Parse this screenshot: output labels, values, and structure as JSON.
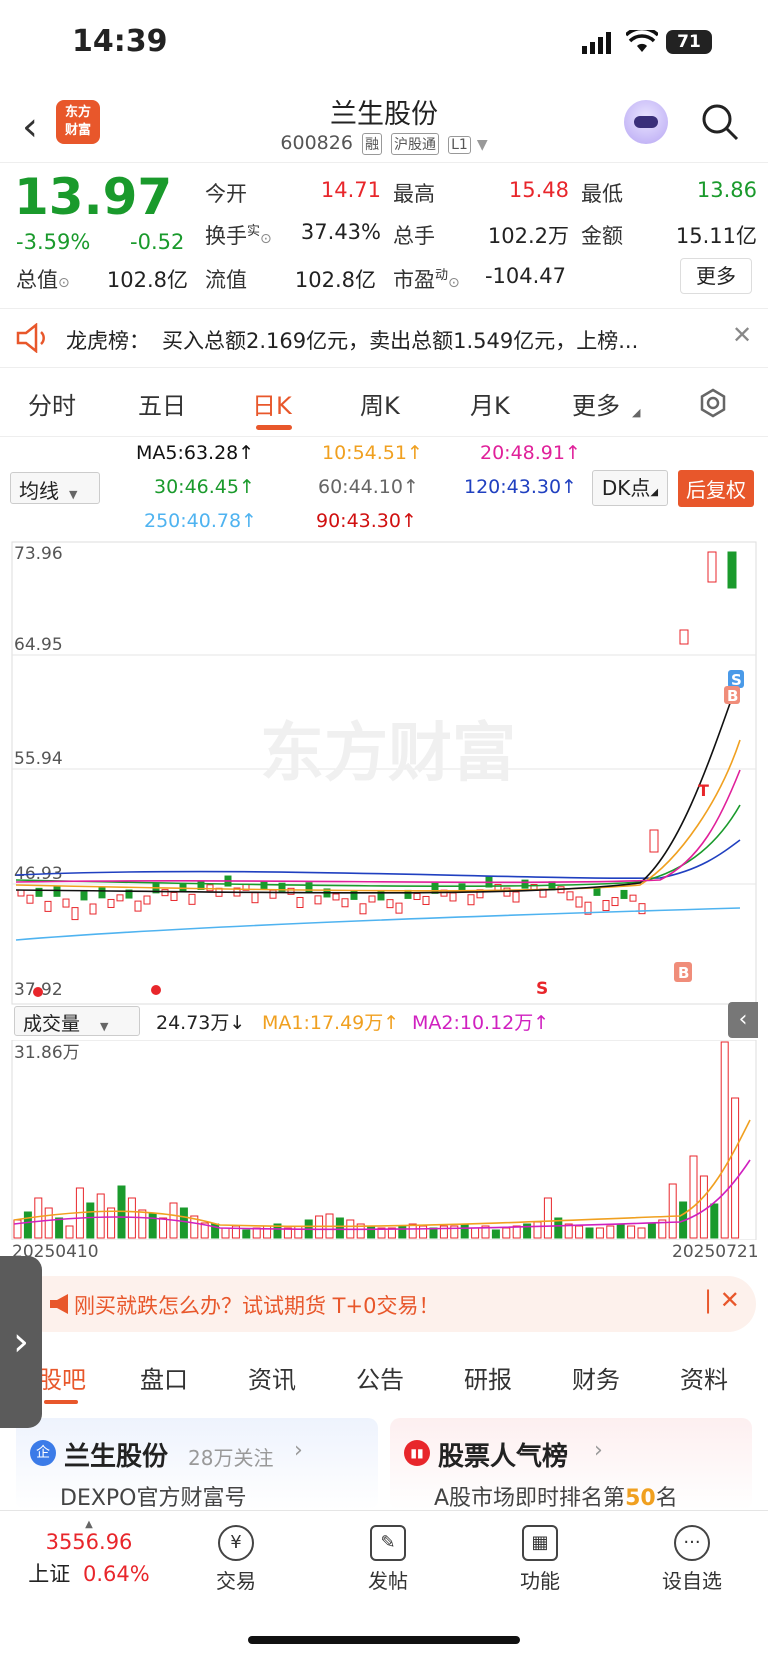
{
  "status_bar": {
    "time": "14:39",
    "battery": "71"
  },
  "header": {
    "name": "兰生股份",
    "code": "600826",
    "tags": [
      "融",
      "沪股通",
      "L1"
    ],
    "logo_lines": [
      "东方",
      "财富"
    ]
  },
  "quote": {
    "price": "13.97",
    "pct": "-3.59%",
    "change": "-0.52",
    "fields": [
      {
        "label": "今开",
        "value": "14.71",
        "color": "red"
      },
      {
        "label": "最高",
        "value": "15.48",
        "color": "red"
      },
      {
        "label": "最低",
        "value": "13.86",
        "color": "green"
      },
      {
        "label": "换手",
        "sup": "实",
        "value": "37.43%",
        "color": "dark"
      },
      {
        "label": "总手",
        "value": "102.2万",
        "color": "dark"
      },
      {
        "label": "金额",
        "value": "15.11亿",
        "color": "dark"
      },
      {
        "label": "总值",
        "value": "102.8亿",
        "color": "dark"
      },
      {
        "label": "流值",
        "value": "102.8亿",
        "color": "dark"
      },
      {
        "label": "市盈",
        "sup": "动",
        "value": "-104.47",
        "color": "dark"
      }
    ],
    "more_label": "更多"
  },
  "longhu": {
    "title": "龙虎榜：",
    "text": "买入总额2.169亿元，卖出总额1.549亿元，上榜..."
  },
  "tabs": [
    "分时",
    "五日",
    "日K",
    "周K",
    "月K",
    "更多"
  ],
  "active_tab": "日K",
  "ma": {
    "selector": "均线",
    "items": [
      {
        "text": "MA5:63.28↑",
        "color": "#111111"
      },
      {
        "text": "10:54.51↑",
        "color": "#f0a020"
      },
      {
        "text": "20:48.91↑",
        "color": "#e0209a"
      },
      {
        "text": "30:46.45↑",
        "color": "#1a9a2c"
      },
      {
        "text": "60:44.10↑",
        "color": "#666666"
      },
      {
        "text": "120:43.30↑",
        "color": "#2040c0"
      },
      {
        "text": "250:40.78↑",
        "color": "#4fb3f0"
      },
      {
        "text": "90:43.30↑",
        "color": "#d01010"
      }
    ],
    "dk_label": "DK点",
    "fq_label": "后复权"
  },
  "price_axis": [
    "73.96",
    "64.95",
    "55.94",
    "46.93",
    "37.92"
  ],
  "watermark": "东方财富",
  "markers": {
    "b": "B",
    "s": "S",
    "t": "T"
  },
  "volume": {
    "selector": "成交量",
    "current": "24.73万↓",
    "ma1": "MA1:17.49万↑",
    "ma2": "MA2:10.12万↑",
    "axis_max": "31.86万",
    "date_start": "20250410",
    "date_end": "20250721"
  },
  "promo": {
    "text": "刚买就跌怎么办？试试期货 T+0交易！"
  },
  "feature_tabs": [
    "股吧",
    "盘口",
    "资讯",
    "公告",
    "研报",
    "财务",
    "资料"
  ],
  "cards": [
    {
      "title": "兰生股份",
      "badge": "企",
      "sub1": "28万关注",
      "sub2": "DEXPO官方财富号"
    },
    {
      "title": "股票人气榜",
      "sub2_pre": "A股市场即时排名第",
      "rank": "50",
      "sub2_post": "名"
    }
  ],
  "index": {
    "value": "3556.96",
    "name": "上证",
    "pct": "0.64%"
  },
  "bottom_nav": [
    {
      "label": "交易",
      "icon": "¥"
    },
    {
      "label": "发帖",
      "icon": "✎"
    },
    {
      "label": "功能",
      "icon": "▦"
    },
    {
      "label": "设自选",
      "icon": "···"
    }
  ]
}
